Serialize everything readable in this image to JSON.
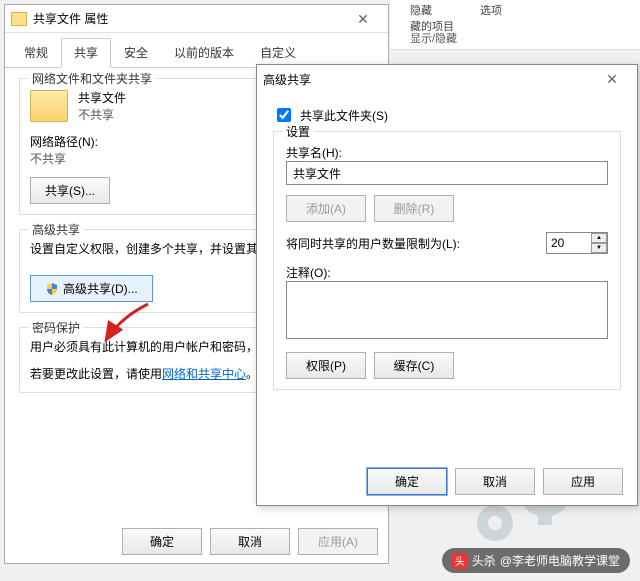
{
  "ribbon": {
    "hide": "隐藏",
    "hidden_items": "藏的项目",
    "options": "选项",
    "group_label": "显示/隐藏"
  },
  "props": {
    "title": "共享文件 属性",
    "tabs": {
      "general": "常规",
      "sharing": "共享",
      "security": "安全",
      "prev": "以前的版本",
      "custom": "自定义"
    },
    "netshare": {
      "heading": "网络文件和文件夹共享",
      "name": "共享文件",
      "status": "不共享",
      "path_label": "网络路径(N):",
      "path_value": "不共享",
      "share_btn": "共享(S)..."
    },
    "advshare": {
      "heading": "高级共享",
      "desc": "设置自定义权限，创建多个共享，并设置其",
      "btn": "高级共享(D)..."
    },
    "pwd": {
      "heading": "密码保护",
      "line1": "用户必须具有此计算机的用户帐户和密码，",
      "line2a": "若要更改此设置，请使用",
      "link": "网络和共享中心",
      "line2b": "。"
    },
    "footer": {
      "ok": "确定",
      "cancel": "取消",
      "apply": "应用(A)"
    }
  },
  "adv": {
    "title": "高级共享",
    "share_this": "共享此文件夹(S)",
    "settings": "设置",
    "sharename_label": "共享名(H):",
    "sharename_value": "共享文件",
    "add_btn": "添加(A)",
    "remove_btn": "删除(R)",
    "limit_label": "将同时共享的用户数量限制为(L):",
    "limit_value": "20",
    "comment_label": "注释(O):",
    "perm_btn": "权限(P)",
    "cache_btn": "缓存(C)",
    "footer": {
      "ok": "确定",
      "cancel": "取消",
      "apply": "应用"
    }
  },
  "watermark": {
    "prefix": "头杀",
    "handle": "@李老师电脑教学课堂"
  }
}
